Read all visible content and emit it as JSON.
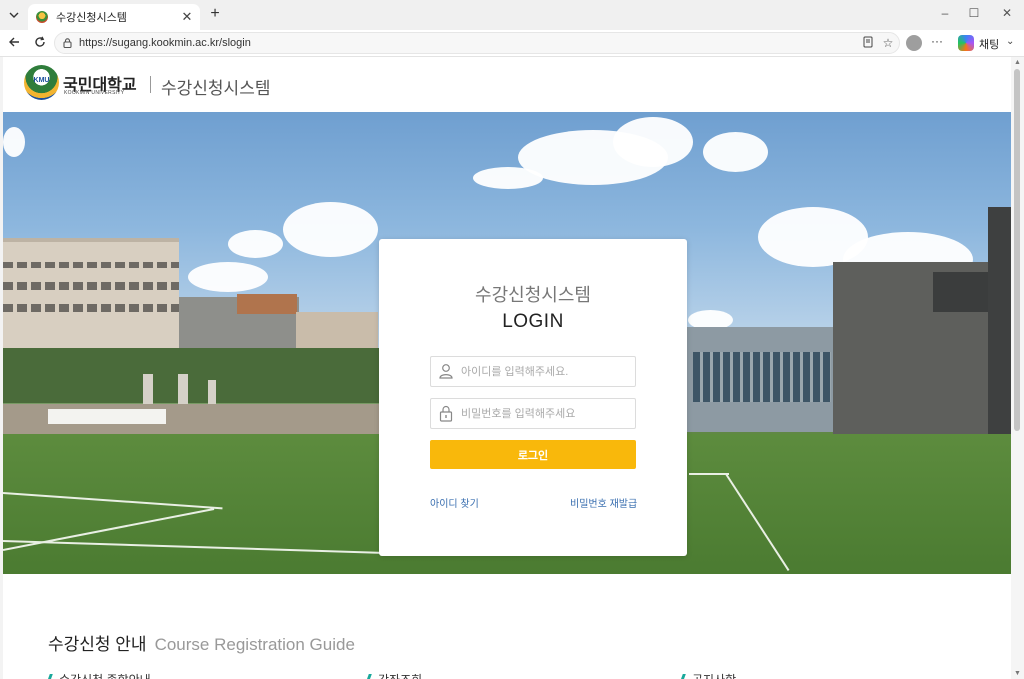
{
  "browser": {
    "tab_title": "수강신청시스템",
    "tab_close": "✕",
    "new_tab": "+",
    "url": "https://sugang.kookmin.ac.kr/slogin",
    "copilot_label": "채팅",
    "window_controls": [
      "–",
      "☐",
      "✕"
    ]
  },
  "site": {
    "logo_ko": "국민대학교",
    "logo_en": "KOOKMIN UNIVERSITY",
    "logo_emblem": "KMU",
    "system_name": "수강신청시스템"
  },
  "login": {
    "system_name": "수강신청시스템",
    "title": "LOGIN",
    "id_placeholder": "아이디를 입력해주세요.",
    "pw_placeholder": "비밀번호를 입력해주세요",
    "button": "로그인",
    "find_id": "아이디 찾기",
    "reset_pw": "비밀번호 재발급",
    "accent_color": "#f9b80b"
  },
  "guide": {
    "title_ko": "수강신청 안내",
    "title_en": "Course Registration Guide",
    "items": [
      "수강신청 종합안내",
      "강좌조회",
      "공지사항"
    ]
  }
}
